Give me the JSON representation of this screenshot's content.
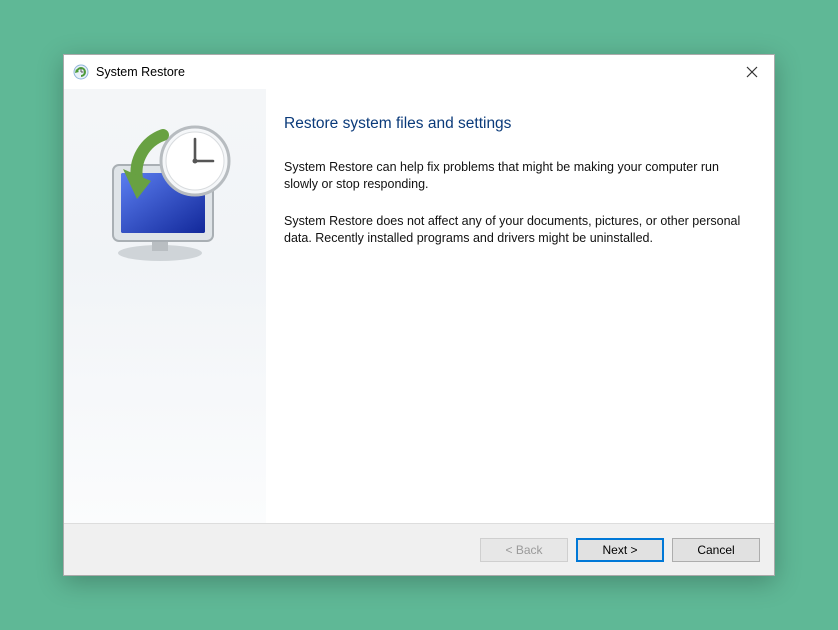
{
  "window": {
    "title": "System Restore",
    "icon": "system-restore-icon"
  },
  "content": {
    "heading": "Restore system files and settings",
    "paragraph1": "System Restore can help fix problems that might be making your computer run slowly or stop responding.",
    "paragraph2": "System Restore does not affect any of your documents, pictures, or other personal data. Recently installed programs and drivers might be uninstalled."
  },
  "buttons": {
    "back": "< Back",
    "next": "Next >",
    "cancel": "Cancel"
  }
}
